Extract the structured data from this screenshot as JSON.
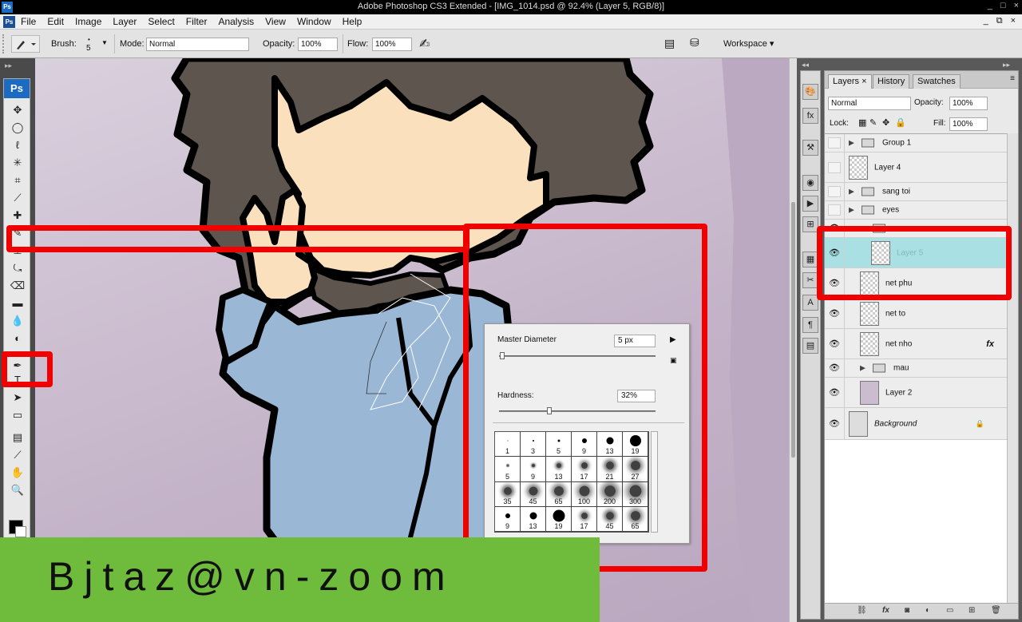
{
  "window": {
    "title": "Adobe Photoshop CS3 Extended - [IMG_1014.psd @ 92.4% (Layer 5, RGB/8)]",
    "app_badge": "Ps",
    "controls": [
      "_",
      "□",
      "×"
    ]
  },
  "menubar": {
    "items": [
      "File",
      "Edit",
      "Image",
      "Layer",
      "Select",
      "Filter",
      "Analysis",
      "View",
      "Window",
      "Help"
    ],
    "doc_controls": [
      "_",
      "⧉",
      "×"
    ]
  },
  "options": {
    "brush_label": "Brush:",
    "brush_size": "5",
    "mode_label": "Mode:",
    "mode_value": "Normal",
    "opacity_label": "Opacity:",
    "opacity_value": "100%",
    "flow_label": "Flow:",
    "flow_value": "100%",
    "workspace_label": "Workspace ▾"
  },
  "toolbox": {
    "header": "Ps",
    "tools": [
      {
        "name": "move-tool",
        "glyph": "✥"
      },
      {
        "name": "marquee-tool",
        "glyph": "◯"
      },
      {
        "name": "lasso-tool",
        "glyph": "ℓ"
      },
      {
        "name": "magic-wand-tool",
        "glyph": "✳"
      },
      {
        "name": "crop-tool",
        "glyph": "⌗"
      },
      {
        "name": "slice-tool",
        "glyph": "⟋"
      },
      {
        "name": "healing-tool",
        "glyph": "✚"
      },
      {
        "name": "brush-tool",
        "glyph": "✎"
      },
      {
        "name": "clone-stamp-tool",
        "glyph": "⊥"
      },
      {
        "name": "history-brush-tool",
        "glyph": "⤿"
      },
      {
        "name": "eraser-tool",
        "glyph": "⌫"
      },
      {
        "name": "gradient-tool",
        "glyph": "▬"
      },
      {
        "name": "blur-tool",
        "glyph": "💧"
      },
      {
        "name": "dodge-tool",
        "glyph": "◐"
      },
      {
        "name": "pen-tool",
        "glyph": "✒"
      },
      {
        "name": "type-tool",
        "glyph": "T"
      },
      {
        "name": "path-selection-tool",
        "glyph": "➤"
      },
      {
        "name": "shape-tool",
        "glyph": "▭"
      },
      {
        "name": "notes-tool",
        "glyph": "▤"
      },
      {
        "name": "eyedropper-tool",
        "glyph": "⟋"
      },
      {
        "name": "hand-tool",
        "glyph": "✋"
      },
      {
        "name": "zoom-tool",
        "glyph": "🔍"
      }
    ]
  },
  "brush_picker": {
    "master_diameter_label": "Master Diameter",
    "master_diameter_value": "5 px",
    "master_diameter_fraction": 0.02,
    "hardness_label": "Hardness:",
    "hardness_value": "32%",
    "hardness_fraction": 0.32,
    "presets": [
      {
        "size": "1",
        "dot": 1,
        "soft": false
      },
      {
        "size": "3",
        "dot": 2,
        "soft": false
      },
      {
        "size": "5",
        "dot": 3,
        "soft": false
      },
      {
        "size": "9",
        "dot": 6,
        "soft": false
      },
      {
        "size": "13",
        "dot": 9,
        "soft": false
      },
      {
        "size": "19",
        "dot": 14,
        "soft": false
      },
      {
        "size": "5",
        "dot": 2,
        "soft": true
      },
      {
        "size": "9",
        "dot": 4,
        "soft": true
      },
      {
        "size": "13",
        "dot": 6,
        "soft": true
      },
      {
        "size": "17",
        "dot": 8,
        "soft": true
      },
      {
        "size": "21",
        "dot": 10,
        "soft": true
      },
      {
        "size": "27",
        "dot": 12,
        "soft": true
      },
      {
        "size": "35",
        "dot": 10,
        "soft": true
      },
      {
        "size": "45",
        "dot": 11,
        "soft": true
      },
      {
        "size": "65",
        "dot": 12,
        "soft": true
      },
      {
        "size": "100",
        "dot": 13,
        "soft": true
      },
      {
        "size": "200",
        "dot": 14,
        "soft": true
      },
      {
        "size": "300",
        "dot": 15,
        "soft": true
      },
      {
        "size": "9",
        "dot": 6,
        "soft": false
      },
      {
        "size": "13",
        "dot": 9,
        "soft": false
      },
      {
        "size": "19",
        "dot": 15,
        "soft": false
      },
      {
        "size": "17",
        "dot": 8,
        "soft": true
      },
      {
        "size": "45",
        "dot": 10,
        "soft": true
      },
      {
        "size": "65",
        "dot": 12,
        "soft": true
      }
    ]
  },
  "layers_panel": {
    "tabs": [
      "Layers ×",
      "History",
      "Swatches"
    ],
    "blend_mode": "Normal",
    "opacity_label": "Opacity:",
    "opacity_value": "100%",
    "lock_label": "Lock:",
    "fill_label": "Fill:",
    "fill_value": "100%",
    "layers": [
      {
        "name": "Group 1",
        "kind": "group",
        "visible": false,
        "expanded": false,
        "indent": 0
      },
      {
        "name": "Layer 4",
        "kind": "layer",
        "visible": false,
        "indent": 0
      },
      {
        "name": "sang toi",
        "kind": "group",
        "visible": false,
        "expanded": false,
        "indent": 0
      },
      {
        "name": "eyes",
        "kind": "group",
        "visible": false,
        "expanded": false,
        "indent": 0
      },
      {
        "name": "ao",
        "kind": "group",
        "visible": true,
        "expanded": true,
        "indent": 1
      },
      {
        "name": "Layer 5",
        "kind": "layer",
        "visible": true,
        "indent": 2,
        "selected": true
      },
      {
        "name": "net phu",
        "kind": "layer",
        "visible": true,
        "indent": 1
      },
      {
        "name": "net to",
        "kind": "layer",
        "visible": true,
        "indent": 1
      },
      {
        "name": "net nho",
        "kind": "layer",
        "visible": true,
        "indent": 1,
        "fx": "fx"
      },
      {
        "name": "mau",
        "kind": "group",
        "visible": true,
        "expanded": false,
        "indent": 1
      },
      {
        "name": "Layer 2",
        "kind": "layer",
        "visible": true,
        "indent": 1
      },
      {
        "name": "Background",
        "kind": "background",
        "visible": true,
        "indent": 0,
        "locked": true
      }
    ]
  },
  "watermark": {
    "text": "Bjtaz@vn-zoom"
  },
  "colors": {
    "annotation_red": "#f10000",
    "watermark_green": "#6fbc3d",
    "selected_layer": "#a9e0e4",
    "shirt_blue": "#9ab7d6",
    "hair_brown": "#5e554f",
    "skin": "#fbe0bd"
  }
}
